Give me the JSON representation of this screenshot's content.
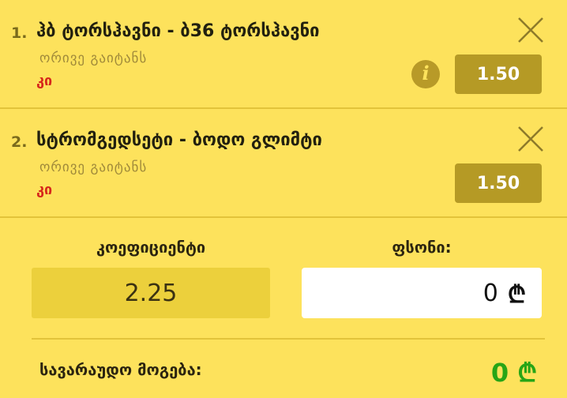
{
  "bets": [
    {
      "index": "1.",
      "match": "ჰბ ტორსჰავნი - ბ36 ტორსჰავნი",
      "market": "ორივე გაიტანს",
      "selection": "კი",
      "odds": "1.50",
      "info_icon": "info-icon",
      "close_icon": "close-icon"
    },
    {
      "index": "2.",
      "match": "სტრომგედსეტი - ბოდო გლიმტი",
      "market": "ორივე გაიტანს",
      "selection": "კი",
      "odds": "1.50",
      "close_icon": "close-icon"
    }
  ],
  "summary": {
    "coefficient_label": "კოეფიციენტი",
    "coefficient_value": "2.25",
    "stake_label": "ფსონი:",
    "stake_value": "0",
    "stake_currency": "₾",
    "win_label": "სავარაუდო მოგება:",
    "win_amount": "0 ₾"
  },
  "colors": {
    "background": "#fde25c",
    "odds_button": "#b59a25",
    "selection_text": "#d6281c",
    "win_amount": "#27a516",
    "coefficient_box": "#ecd03c"
  }
}
